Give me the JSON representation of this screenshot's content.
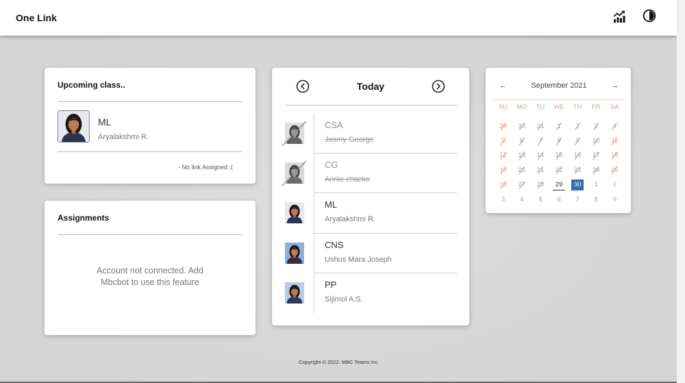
{
  "app": {
    "title": "One Link"
  },
  "header": {
    "icons": {
      "stats": "chart-line-up-icon",
      "theme": "contrast-icon"
    }
  },
  "upcoming": {
    "title": "Upcoming class..",
    "subject": "ML",
    "teacher": "Aryalakshmi R.",
    "photo_bg": "#e6eaef",
    "link_status": "- No link Assigned :("
  },
  "assignments": {
    "title": "Assignments",
    "message": "Account not connected. Add Mbcbot to use this feature"
  },
  "schedule": {
    "title": "Today",
    "prev_icon": "chevron-left-circle-icon",
    "next_icon": "chevron-right-circle-icon",
    "classes": [
      {
        "subject": "CSA",
        "teacher": "Josmy George",
        "crossed_out": true,
        "photo_bg": "#d6d6d6"
      },
      {
        "subject": "CG",
        "teacher": "Annie chacko",
        "crossed_out": true,
        "photo_bg": "#d2d2d2"
      },
      {
        "subject": "ML",
        "teacher": "Aryalakshmi R.",
        "crossed_out": false,
        "photo_bg": "#e3e8ee"
      },
      {
        "subject": "CNS",
        "teacher": "Ushus Mara Joseph",
        "crossed_out": false,
        "photo_bg": "#8db0dc"
      },
      {
        "subject": "PP",
        "teacher": "Sijimol A.S.",
        "crossed_out": false,
        "photo_bg": "#b7cce8"
      }
    ]
  },
  "calendar": {
    "prev_label": "←",
    "month_label": "September 2021",
    "next_label": "→",
    "weekdays": [
      "SU",
      "MO",
      "TU",
      "WE",
      "TH",
      "FR",
      "SA"
    ],
    "weeks": [
      [
        {
          "d": "29",
          "crossed": true
        },
        {
          "d": "30",
          "crossed": true
        },
        {
          "d": "31",
          "crossed": true
        },
        {
          "d": "1",
          "crossed": true
        },
        {
          "d": "2",
          "crossed": true
        },
        {
          "d": "3",
          "crossed": true
        },
        {
          "d": "4",
          "crossed": true
        }
      ],
      [
        {
          "d": "5",
          "crossed": true
        },
        {
          "d": "6",
          "crossed": true
        },
        {
          "d": "7",
          "crossed": true
        },
        {
          "d": "8",
          "crossed": true
        },
        {
          "d": "9",
          "crossed": true
        },
        {
          "d": "10",
          "crossed": true
        },
        {
          "d": "11",
          "crossed": true
        }
      ],
      [
        {
          "d": "12",
          "crossed": true
        },
        {
          "d": "13",
          "crossed": true
        },
        {
          "d": "14",
          "crossed": true
        },
        {
          "d": "15",
          "crossed": true
        },
        {
          "d": "16",
          "crossed": true
        },
        {
          "d": "17",
          "crossed": true
        },
        {
          "d": "18",
          "crossed": true
        }
      ],
      [
        {
          "d": "19",
          "crossed": true
        },
        {
          "d": "20",
          "crossed": true
        },
        {
          "d": "21",
          "crossed": true
        },
        {
          "d": "22",
          "crossed": true
        },
        {
          "d": "23",
          "crossed": true
        },
        {
          "d": "24",
          "crossed": true
        },
        {
          "d": "25",
          "crossed": true
        }
      ],
      [
        {
          "d": "26",
          "crossed": true
        },
        {
          "d": "27",
          "crossed": true
        },
        {
          "d": "28",
          "crossed": true
        },
        {
          "d": "29",
          "underlined": true
        },
        {
          "d": "30",
          "selected": true
        },
        {
          "d": "1"
        },
        {
          "d": "2"
        }
      ],
      [
        {
          "d": "3"
        },
        {
          "d": "4"
        },
        {
          "d": "5"
        },
        {
          "d": "6"
        },
        {
          "d": "7"
        },
        {
          "d": "8"
        },
        {
          "d": "9"
        }
      ]
    ]
  },
  "footer": {
    "copyright": "Copyright © 2022. MBC Teams Inc"
  },
  "colors": {
    "accent": "#2f6cb3",
    "weekend": "#e5968a",
    "weekday": "#9e9e9e",
    "weekday_header": "#e29d92",
    "today": "#333333"
  }
}
